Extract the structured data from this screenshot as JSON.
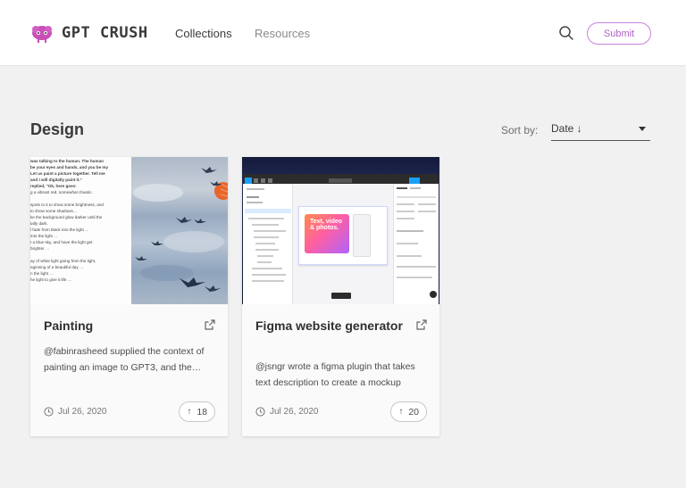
{
  "brand": {
    "name": "GPT CRUSH"
  },
  "nav": {
    "collections": "Collections",
    "resources": "Resources"
  },
  "actions": {
    "submit_label": "Submit",
    "search_icon": "search-icon"
  },
  "page": {
    "title": "Design",
    "sort_label": "Sort by:",
    "sort_value": "Date ↓"
  },
  "colors": {
    "accent": "#b160c6",
    "background": "#f1f1f2",
    "card": "#ffffff"
  },
  "cards": [
    {
      "title": "Painting",
      "description": "@fabinrasheed supplied the context of painting an image to GPT3, and the…",
      "date": "Jul 26, 2020",
      "upvotes": "18",
      "thumb_text": [
        "was talking to the human. The human",
        "be your eyes and hands, and you be my",
        "Let us paint a picture together. Tell me",
        "and I will digitally paint it.\"",
        "replied, \"Ok, here goes:",
        "g a vibrant red, somewhat chaotic.",
        "",
        "spots to it to show some brightness, and",
        "to show some shadows…",
        "ke the background glow darker until the",
        "tally dark.",
        "l fade from black into the light …",
        "into the light …",
        "t a blue sky, and have the light get",
        "brighter …",
        "",
        "ay of white light going from the light,",
        "eginning of a beautiful day …",
        "n the light …",
        "he light to give it life …"
      ]
    },
    {
      "title": "Figma website generator",
      "description": "@jsngr wrote a figma plugin that takes text description to create a mockup",
      "date": "Jul 26, 2020",
      "upvotes": "20",
      "thumb_text": {
        "hero": "Text, video & photos."
      }
    }
  ]
}
